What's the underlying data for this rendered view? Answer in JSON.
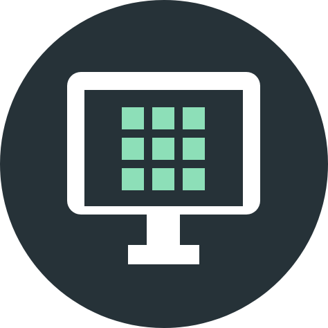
{
  "icon": {
    "name": "desktop-app-grid-icon",
    "colors": {
      "background_circle": "#263238",
      "monitor_frame": "#ffffff",
      "screen": "#263238",
      "grid_tiles": "#8DDFB8"
    },
    "grid": {
      "rows": 3,
      "cols": 3
    }
  }
}
